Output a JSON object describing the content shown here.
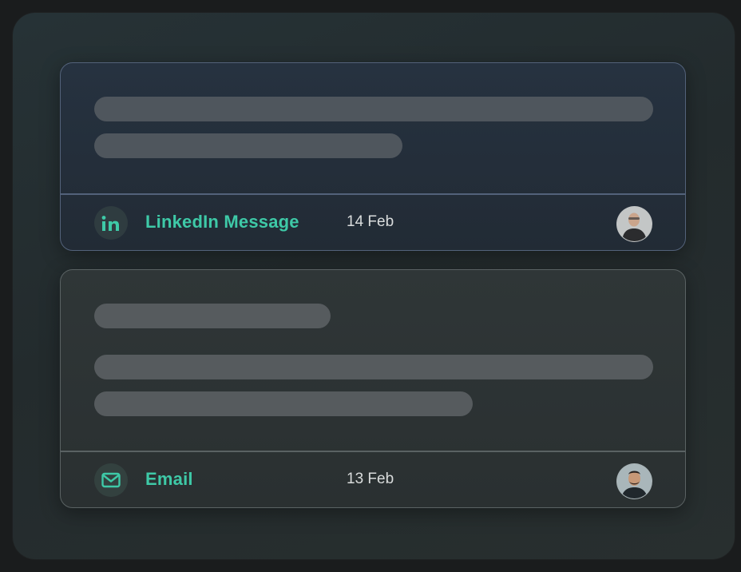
{
  "messages": [
    {
      "channel_label": "LinkedIn Message",
      "channel_icon": "linkedin-icon",
      "date": "14 Feb",
      "accent_color": "#3ec9a7"
    },
    {
      "channel_label": "Email",
      "channel_icon": "email-icon",
      "date": "13 Feb",
      "accent_color": "#3ec9a7"
    }
  ]
}
